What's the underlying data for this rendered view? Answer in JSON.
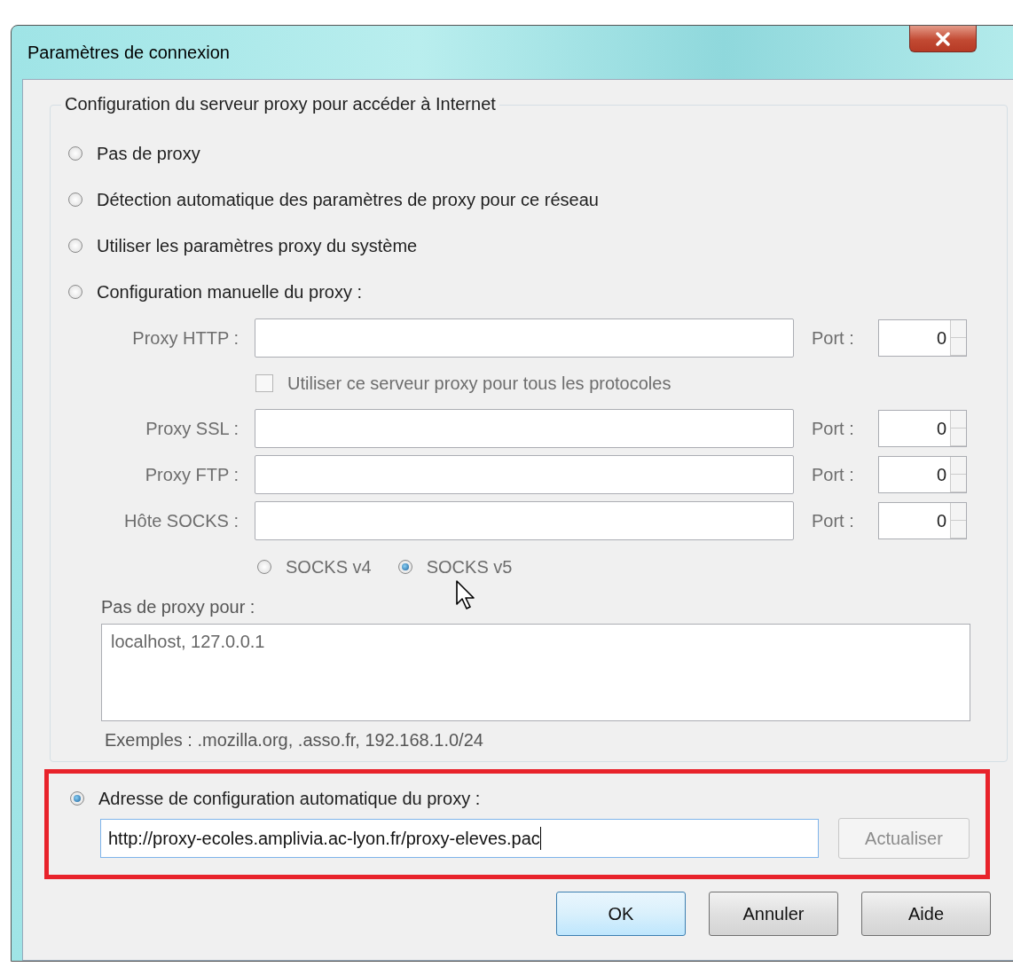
{
  "window": {
    "title": "Paramètres de connexion"
  },
  "group": {
    "legend": "Configuration du serveur proxy pour accéder à Internet"
  },
  "modes": [
    {
      "label": "Pas de proxy",
      "selected": false
    },
    {
      "label": "Détection automatique des paramètres de proxy pour ce réseau",
      "selected": false
    },
    {
      "label": "Utiliser les paramètres proxy du système",
      "selected": false
    },
    {
      "label": "Configuration manuelle du proxy :",
      "selected": false
    }
  ],
  "manual": {
    "disabled": true,
    "proxies": [
      {
        "label": "Proxy HTTP :",
        "port_label": "Port :",
        "port": "0"
      },
      {
        "label": "Proxy SSL :",
        "port_label": "Port :",
        "port": "0"
      },
      {
        "label": "Proxy FTP :",
        "port_label": "Port :",
        "port": "0"
      },
      {
        "label": "Hôte SOCKS :",
        "port_label": "Port :",
        "port": "0"
      }
    ],
    "share_all": {
      "label": "Utiliser ce serveur proxy pour tous les protocoles",
      "checked": false
    },
    "socks_versions": [
      {
        "label": "SOCKS v4",
        "selected": false
      },
      {
        "label": "SOCKS v5",
        "selected": true
      }
    ]
  },
  "no_proxy": {
    "label": "Pas de proxy pour :",
    "value": "localhost, 127.0.0.1",
    "examples": "Exemples : .mozilla.org, .asso.fr, 192.168.1.0/24"
  },
  "auto": {
    "label": "Adresse de configuration automatique du proxy :",
    "selected": true,
    "url": "http://proxy-ecoles.amplivia.ac-lyon.fr/proxy-eleves.pac",
    "reload": "Actualiser",
    "reload_disabled": true
  },
  "buttons": [
    {
      "label": "OK",
      "default": true
    },
    {
      "label": "Annuler",
      "default": false
    },
    {
      "label": "Aide",
      "default": false
    }
  ]
}
